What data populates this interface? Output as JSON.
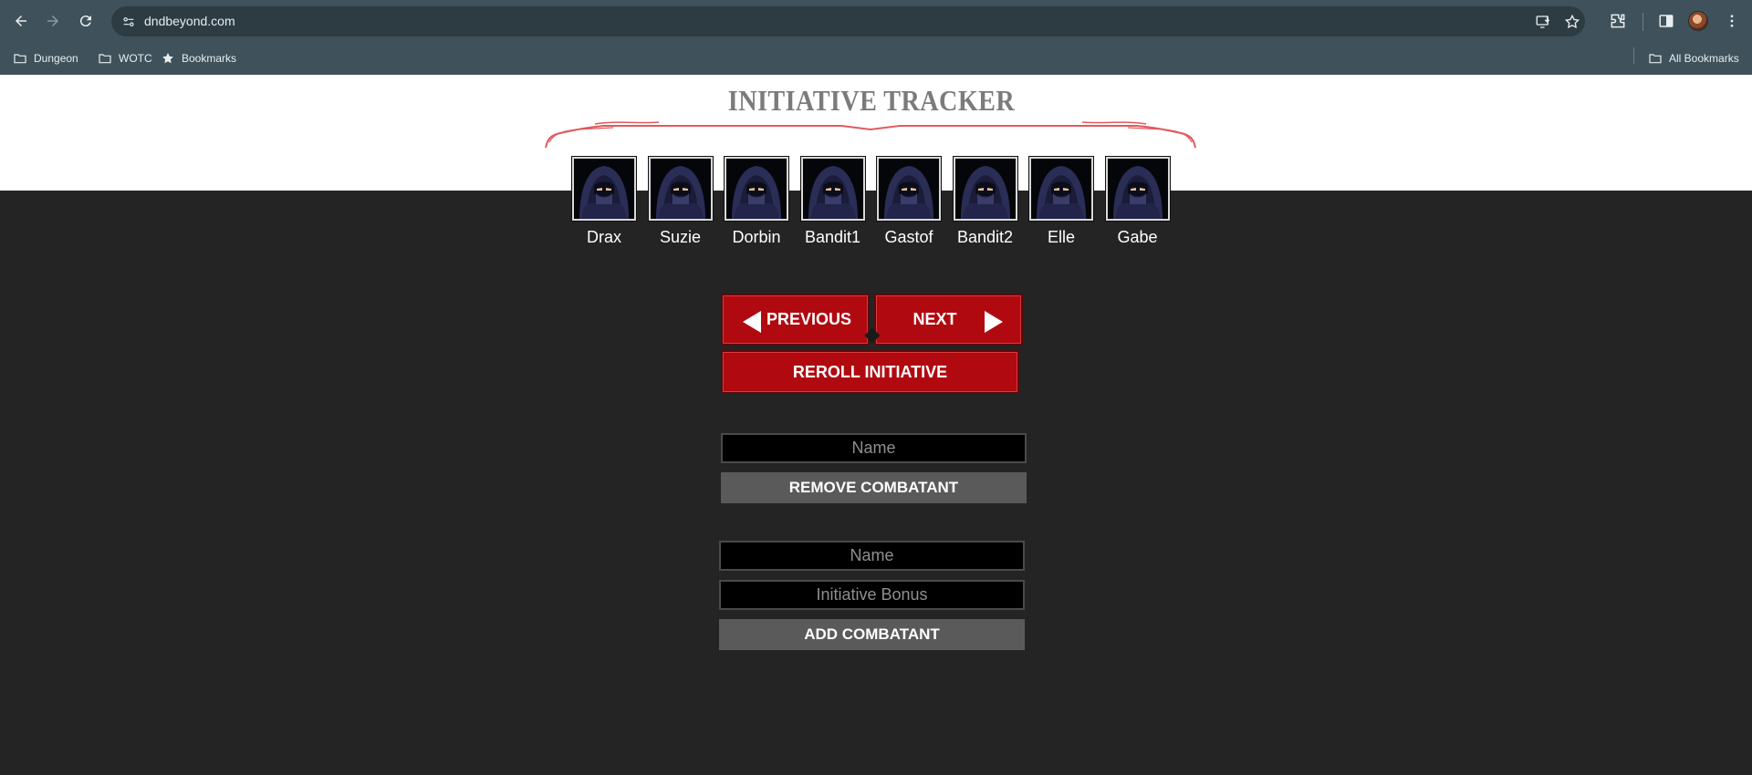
{
  "browser": {
    "url": "dndbeyond.com",
    "bookmarks": [
      {
        "label": "Dungeon",
        "icon": "folder-icon"
      },
      {
        "label": "WOTC",
        "icon": "folder-icon"
      },
      {
        "label": "Bookmarks",
        "icon": "star-icon"
      }
    ],
    "all_bookmarks_label": "All Bookmarks"
  },
  "tracker": {
    "title": "INITIATIVE TRACKER",
    "combatants": [
      {
        "name": "Drax"
      },
      {
        "name": "Suzie"
      },
      {
        "name": "Dorbin"
      },
      {
        "name": "Bandit1"
      },
      {
        "name": "Gastof"
      },
      {
        "name": "Bandit2"
      },
      {
        "name": "Elle"
      },
      {
        "name": "Gabe"
      }
    ],
    "previous_label": "PREVIOUS",
    "next_label": "NEXT",
    "reroll_label": "REROLL INITIATIVE"
  },
  "remove_form": {
    "name_placeholder": "Name",
    "name_value": "",
    "button_label": "REMOVE COMBATANT"
  },
  "add_form": {
    "name_placeholder": "Name",
    "name_value": "",
    "bonus_placeholder": "Initiative Bonus",
    "bonus_value": "",
    "button_label": "ADD COMBATANT"
  },
  "colors": {
    "chrome": "#3f525b",
    "page_bg": "#242424",
    "accent_red": "#b00a10",
    "title_gray": "#7b7b7b"
  }
}
